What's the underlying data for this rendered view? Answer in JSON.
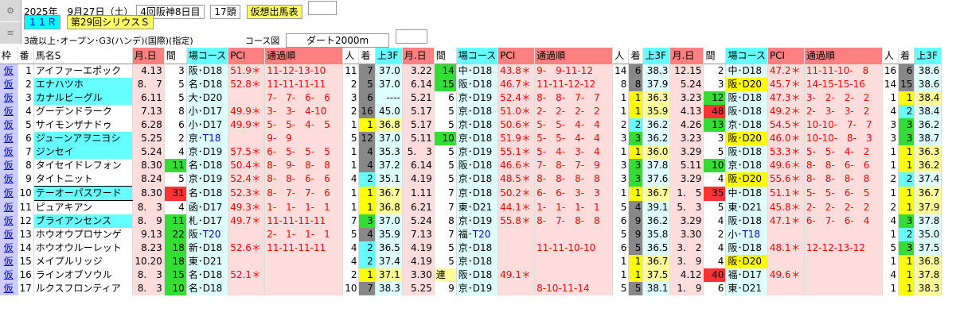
{
  "header": {
    "line1": {
      "date": "2025年　9月27日（土）",
      "meet": "4回阪神8日目",
      "count": "17頭",
      "button": "仮想出馬表"
    },
    "line2": {
      "race_no": "１１Ｒ",
      "race_name": "第29回シリウスＳ"
    },
    "line3": {
      "conditions": "3歳以上･オープン･G3(ハンデ)(国際)(指定)",
      "course_label": "コース図",
      "course": "ダート2000m"
    },
    "side_icons": [
      "gear-icon",
      "settings-icon"
    ]
  },
  "columns": {
    "waku": "枠",
    "ban": "番",
    "name": "馬名S",
    "date": "月.日",
    "kan": "間",
    "course": "場コース",
    "pci": "PCI",
    "tsuka": "通過順",
    "nin": "人",
    "chaku": "着",
    "agari": "上3F"
  },
  "horses": [
    {
      "waku": "仮",
      "ban": "1",
      "name": "アイファーエポック",
      "r": [
        {
          "date": "4.13",
          "kan": "3",
          "ba": "阪",
          "crs": "･D18",
          "pci": "51.9＊",
          "tsuka": "11-12-13-10",
          "nin": "11",
          "chaku": "7",
          "agari": "37.0"
        },
        {
          "date": "3.22",
          "kan": "14",
          "ba": "中",
          "crs": "･D18",
          "pci": "43.8＊",
          "tsuka": "9-　9-11-12",
          "nin": "14",
          "chaku": "6",
          "agari": "38.3"
        },
        {
          "date": "12.15",
          "kan": "2",
          "ba": "中",
          "crs": "･D18",
          "pci": "47.2＊",
          "tsuka": "11-11-10-　8",
          "nin": "16",
          "chaku": "6",
          "agari": "38.6"
        }
      ]
    },
    {
      "waku": "仮",
      "ban": "2",
      "name": "エナハツホ",
      "r": [
        {
          "date": "8.　7",
          "kan": "5",
          "ba": "名",
          "crs": "･D18",
          "pci": "52.8＊",
          "tsuka": "11-11-11-11",
          "nin": "2",
          "chaku": "5",
          "agari": "37.0"
        },
        {
          "date": "6.14",
          "kan": "15",
          "ba": "阪",
          "crs": "･D18",
          "pci": "46.7＊",
          "tsuka": "11-11-12-12",
          "nin": "8",
          "chaku": "8",
          "agari": "37.9"
        },
        {
          "date": "5.24",
          "kan": "3",
          "ba": "阪",
          "crs": "･D20",
          "pci": "45.7＊",
          "tsuka": "14-15-15-16",
          "nin": "14",
          "chaku": "15",
          "agari": "38.6"
        }
      ]
    },
    {
      "waku": "仮",
      "ban": "3",
      "name": "カナルビーグル",
      "r": [
        {
          "date": "6.11",
          "kan": "5",
          "ba": "大",
          "crs": "･D20",
          "pci": "",
          "tsuka": "7-　7-　6-　6",
          "nin": "3",
          "chaku": "6",
          "agari": "----"
        },
        {
          "date": "5.21",
          "kan": "6",
          "ba": "京",
          "crs": "･D19",
          "pci": "52.4＊",
          "tsuka": "8-　8-　7-　7",
          "nin": "1",
          "chaku": "1",
          "agari": "36.3"
        },
        {
          "date": "3.23",
          "kan": "12",
          "ba": "阪",
          "crs": "･D18",
          "pci": "47.3＊",
          "tsuka": "3-　2-　2-　2",
          "nin": "1",
          "chaku": "1",
          "agari": "38.4"
        }
      ]
    },
    {
      "waku": "仮",
      "ban": "4",
      "name": "グーデンドラーク",
      "r": [
        {
          "date": "7.13",
          "kan": "8",
          "ba": "小",
          "crs": "･D17",
          "pci": "49.9＊",
          "tsuka": "3-　3-　4-10",
          "nin": "2",
          "chaku": "16",
          "agari": "45.0"
        },
        {
          "date": "5.17",
          "kan": "5",
          "ba": "京",
          "crs": "･D18",
          "pci": "51.0＊",
          "tsuka": "2-　2-　2-　2",
          "nin": "1",
          "chaku": "1",
          "agari": "35.9"
        },
        {
          "date": "4.13",
          "kan": "48",
          "ba": "阪",
          "crs": "･D18",
          "pci": "49.2＊",
          "tsuka": "2-　3-　3-　2",
          "nin": "4",
          "chaku": "2",
          "agari": "38.4"
        }
      ]
    },
    {
      "waku": "仮",
      "ban": "5",
      "name": "サイモンザナドゥ",
      "r": [
        {
          "date": "6.28",
          "kan": "6",
          "ba": "小",
          "crs": "･D17",
          "pci": "49.9＊",
          "tsuka": "5-　5-　4-　5",
          "nin": "1",
          "chaku": "1",
          "agari": "36.8"
        },
        {
          "date": "5.17",
          "kan": "5",
          "ba": "京",
          "crs": "･D18",
          "pci": "50.6＊",
          "tsuka": "5-　5-　4-　4",
          "nin": "2",
          "chaku": "2",
          "agari": "36.2"
        },
        {
          "date": "4.26",
          "kan": "13",
          "ba": "京",
          "crs": "･D18",
          "pci": "54.5＊",
          "tsuka": "10-10-　7-　7",
          "nin": "3",
          "chaku": "3",
          "agari": "36.2"
        }
      ]
    },
    {
      "waku": "仮",
      "ban": "6",
      "name": "ジューンアヲニヨシ",
      "r": [
        {
          "date": "5.25",
          "kan": "2",
          "ba": "京",
          "crs": "･T18",
          "pci": "",
          "tsuka": "9-　9",
          "nin": "5",
          "chaku": "12",
          "agari": "37.0"
        },
        {
          "date": "5.11",
          "kan": "10",
          "ba": "京",
          "crs": "･D18",
          "pci": "51.9＊",
          "tsuka": "5-　5-　4-　4",
          "nin": "3",
          "chaku": "3",
          "agari": "36.2"
        },
        {
          "date": "3.23",
          "kan": "3",
          "ba": "阪",
          "crs": "･D20",
          "pci": "46.0＊",
          "tsuka": "10-10-　8-　3",
          "nin": "3",
          "chaku": "3",
          "agari": "38.7"
        }
      ]
    },
    {
      "waku": "仮",
      "ban": "7",
      "name": "ジンセイ",
      "r": [
        {
          "date": "5.24",
          "kan": "4",
          "ba": "京",
          "crs": "･D19",
          "pci": "57.5＊",
          "tsuka": "6-　5-　5-　5",
          "nin": "1",
          "chaku": "4",
          "agari": "35.3"
        },
        {
          "date": "5.　3",
          "kan": "5",
          "ba": "京",
          "crs": "･D19",
          "pci": "55.1＊",
          "tsuka": "5-　4-　3-　4",
          "nin": "1",
          "chaku": "1",
          "agari": "36.0"
        },
        {
          "date": "3.29",
          "kan": "5",
          "ba": "阪",
          "crs": "･D18",
          "pci": "53.3＊",
          "tsuka": "5-　5-　4-　2",
          "nin": "1",
          "chaku": "1",
          "agari": "36.3"
        }
      ]
    },
    {
      "waku": "仮",
      "ban": "8",
      "name": "タイセイドレフォン",
      "r": [
        {
          "date": "8.30",
          "kan": "11",
          "ba": "名",
          "crs": "･D18",
          "pci": "50.4＊",
          "tsuka": "8-　9-　8-　8",
          "nin": "1",
          "chaku": "4",
          "agari": "37.2"
        },
        {
          "date": "6.14",
          "kan": "5",
          "ba": "阪",
          "crs": "･D18",
          "pci": "46.6＊",
          "tsuka": "7-　8-　7-　9",
          "nin": "3",
          "chaku": "3",
          "agari": "37.8"
        },
        {
          "date": "5.11",
          "kan": "10",
          "ba": "京",
          "crs": "･D18",
          "pci": "49.6＊",
          "tsuka": "8-　8-　6-　6",
          "nin": "1",
          "chaku": "1",
          "agari": "36.2"
        }
      ]
    },
    {
      "waku": "仮",
      "ban": "9",
      "name": "タイトニット",
      "r": [
        {
          "date": "8.24",
          "kan": "5",
          "ba": "京",
          "crs": "･D19",
          "pci": "52.4＊",
          "tsuka": "8-　8-　6-　6",
          "nin": "4",
          "chaku": "2",
          "agari": "35.1"
        },
        {
          "date": "4.19",
          "kan": "5",
          "ba": "京",
          "crs": "･D18",
          "pci": "48.5＊",
          "tsuka": "8-　8-　8-　8",
          "nin": "3",
          "chaku": "3",
          "agari": "37.6"
        },
        {
          "date": "3.29",
          "kan": "4",
          "ba": "阪",
          "crs": "･D20",
          "pci": "55.6＊",
          "tsuka": "8-　8-　8-　8",
          "nin": "2",
          "chaku": "2",
          "agari": "37.4"
        }
      ]
    },
    {
      "waku": "仮",
      "ban": "10",
      "name": "テーオーパスワード",
      "r": [
        {
          "date": "8.30",
          "kan": "31",
          "ba": "名",
          "crs": "･D18",
          "pci": "52.3＊",
          "tsuka": "8-　7-　7-　6",
          "nin": "1",
          "chaku": "1",
          "agari": "36.7"
        },
        {
          "date": "1.11",
          "kan": "7",
          "ba": "京",
          "crs": "･D18",
          "pci": "50.2＊",
          "tsuka": "6-　6-　3-　3",
          "nin": "1",
          "chaku": "1",
          "agari": "36.7"
        },
        {
          "date": "1.　5",
          "kan": "35",
          "ba": "中",
          "crs": "･D18",
          "pci": "51.1＊",
          "tsuka": "5-　5-　6-　5",
          "nin": "1",
          "chaku": "1",
          "agari": "36.7"
        }
      ]
    },
    {
      "waku": "仮",
      "ban": "11",
      "name": "ピュアキアン",
      "r": [
        {
          "date": "8.　3",
          "kan": "4",
          "ba": "函",
          "crs": "･D17",
          "pci": "49.3＊",
          "tsuka": "1-　1-　1-　1",
          "nin": "1",
          "chaku": "1",
          "agari": "36.8"
        },
        {
          "date": "6.21",
          "kan": "7",
          "ba": "東",
          "crs": "･D21",
          "pci": "44.1＊",
          "tsuka": "1-　1-　1-　1",
          "nin": "5",
          "chaku": "4",
          "agari": "39.1"
        },
        {
          "date": "5.　3",
          "kan": "5",
          "ba": "東",
          "crs": "･D21",
          "pci": "45.8＊",
          "tsuka": "2-　2-　2-　2",
          "nin": "2",
          "chaku": "1",
          "agari": "37.9"
        }
      ]
    },
    {
      "waku": "仮",
      "ban": "12",
      "name": "ブライアンセンス",
      "r": [
        {
          "date": "8.　9",
          "kan": "11",
          "ba": "札",
          "crs": "･D17",
          "pci": "49.7＊",
          "tsuka": "11-11-11-11",
          "nin": "7",
          "chaku": "3",
          "agari": "37.0"
        },
        {
          "date": "5.24",
          "kan": "8",
          "ba": "京",
          "crs": "･D19",
          "pci": "55.8＊",
          "tsuka": "8-　7-　8-　8",
          "nin": "6",
          "chaku": "9",
          "agari": "36.2"
        },
        {
          "date": "3.29",
          "kan": "4",
          "ba": "阪",
          "crs": "･D18",
          "pci": "47.1＊",
          "tsuka": "6-　7-　6-　4",
          "nin": "4",
          "chaku": "3",
          "agari": "37.8"
        }
      ]
    },
    {
      "waku": "仮",
      "ban": "13",
      "name": "ホウオウプロサンゲ",
      "r": [
        {
          "date": "9.13",
          "kan": "22",
          "ba": "阪",
          "crs": "･T20",
          "pci": "",
          "tsuka": "2-　1-　1-　1",
          "nin": "5",
          "chaku": "4",
          "agari": "35.9"
        },
        {
          "date": "7.13",
          "kan": "7",
          "ba": "福",
          "crs": "･T20",
          "pci": "",
          "tsuka": "",
          "nin": "5",
          "chaku": "9",
          "agari": "35.8"
        },
        {
          "date": "3.30",
          "kan": "2",
          "ba": "小",
          "crs": "･T18",
          "pci": "",
          "tsuka": "",
          "nin": "1",
          "chaku": "2",
          "agari": "35.0"
        }
      ]
    },
    {
      "waku": "仮",
      "ban": "14",
      "name": "ホウオウルーレット",
      "r": [
        {
          "date": "8.23",
          "kan": "18",
          "ba": "新",
          "crs": "･D18",
          "pci": "52.6＊",
          "tsuka": "11-11-11-11",
          "nin": "4",
          "chaku": "2",
          "agari": "36.5"
        },
        {
          "date": "4.19",
          "kan": "5",
          "ba": "京",
          "crs": "･D18",
          "pci": "",
          "tsuka": "11-11-10-10",
          "nin": "6",
          "chaku": "5",
          "agari": "36.5"
        },
        {
          "date": "3.　2",
          "kan": "4",
          "ba": "阪",
          "crs": "･D18",
          "pci": "48.1＊",
          "tsuka": "12-12-13-12",
          "nin": "5",
          "chaku": "3",
          "agari": "37.5"
        }
      ]
    },
    {
      "waku": "仮",
      "ban": "15",
      "name": "メイプルリッジ",
      "r": [
        {
          "date": "10.20",
          "kan": "18",
          "ba": "東",
          "crs": "･D21",
          "pci": "",
          "tsuka": "",
          "nin": "4",
          "chaku": "2",
          "agari": "37.4"
        },
        {
          "date": "4.19",
          "kan": "5",
          "ba": "京",
          "crs": "･D18",
          "pci": "",
          "tsuka": "",
          "nin": "1",
          "chaku": "1",
          "agari": "36.7"
        },
        {
          "date": "3.　9",
          "kan": "4",
          "ba": "阪",
          "crs": "･D20",
          "pci": "",
          "tsuka": "",
          "nin": "1",
          "chaku": "1",
          "agari": "36.8"
        }
      ]
    },
    {
      "waku": "仮",
      "ban": "16",
      "name": "ラインオブソウル",
      "r": [
        {
          "date": "8.　3",
          "kan": "15",
          "ba": "名",
          "crs": "･D18",
          "pci": "52.1＊",
          "tsuka": "",
          "nin": "2",
          "chaku": "1",
          "agari": "37.1"
        },
        {
          "date": "3.30",
          "kan": "連",
          "ba": "阪",
          "crs": "･D18",
          "pci": "49.1＊",
          "tsuka": "",
          "nin": "1",
          "chaku": "1",
          "agari": "37.5"
        },
        {
          "date": "4.12",
          "kan": "40",
          "ba": "福",
          "crs": "･D17",
          "pci": "49.6＊",
          "tsuka": "",
          "nin": "4",
          "chaku": "1",
          "agari": "37.8"
        }
      ]
    },
    {
      "waku": "仮",
      "ban": "17",
      "name": "ルクスフロンティア",
      "r": [
        {
          "date": "8.　3",
          "kan": "10",
          "ba": "名",
          "crs": "･D18",
          "pci": "",
          "tsuka": "",
          "nin": "10",
          "chaku": "7",
          "agari": "38.3"
        },
        {
          "date": "5.25",
          "kan": "9",
          "ba": "京",
          "crs": "･D19",
          "pci": "",
          "tsuka": "8-10-11-14",
          "nin": "5",
          "chaku": "5",
          "agari": "38.1"
        },
        {
          "date": "1.　9",
          "kan": "6",
          "ba": "東",
          "crs": "･D21",
          "pci": "",
          "tsuka": "",
          "nin": "1",
          "chaku": "1",
          "agari": "38.3"
        }
      ]
    }
  ],
  "colors": {
    "header_pink": "#ff8080",
    "header_cyan": "#66ffff",
    "waku_bg": "#ccccff",
    "kan_green": "#33dd33",
    "chaku_yellow": "#ffff00"
  }
}
